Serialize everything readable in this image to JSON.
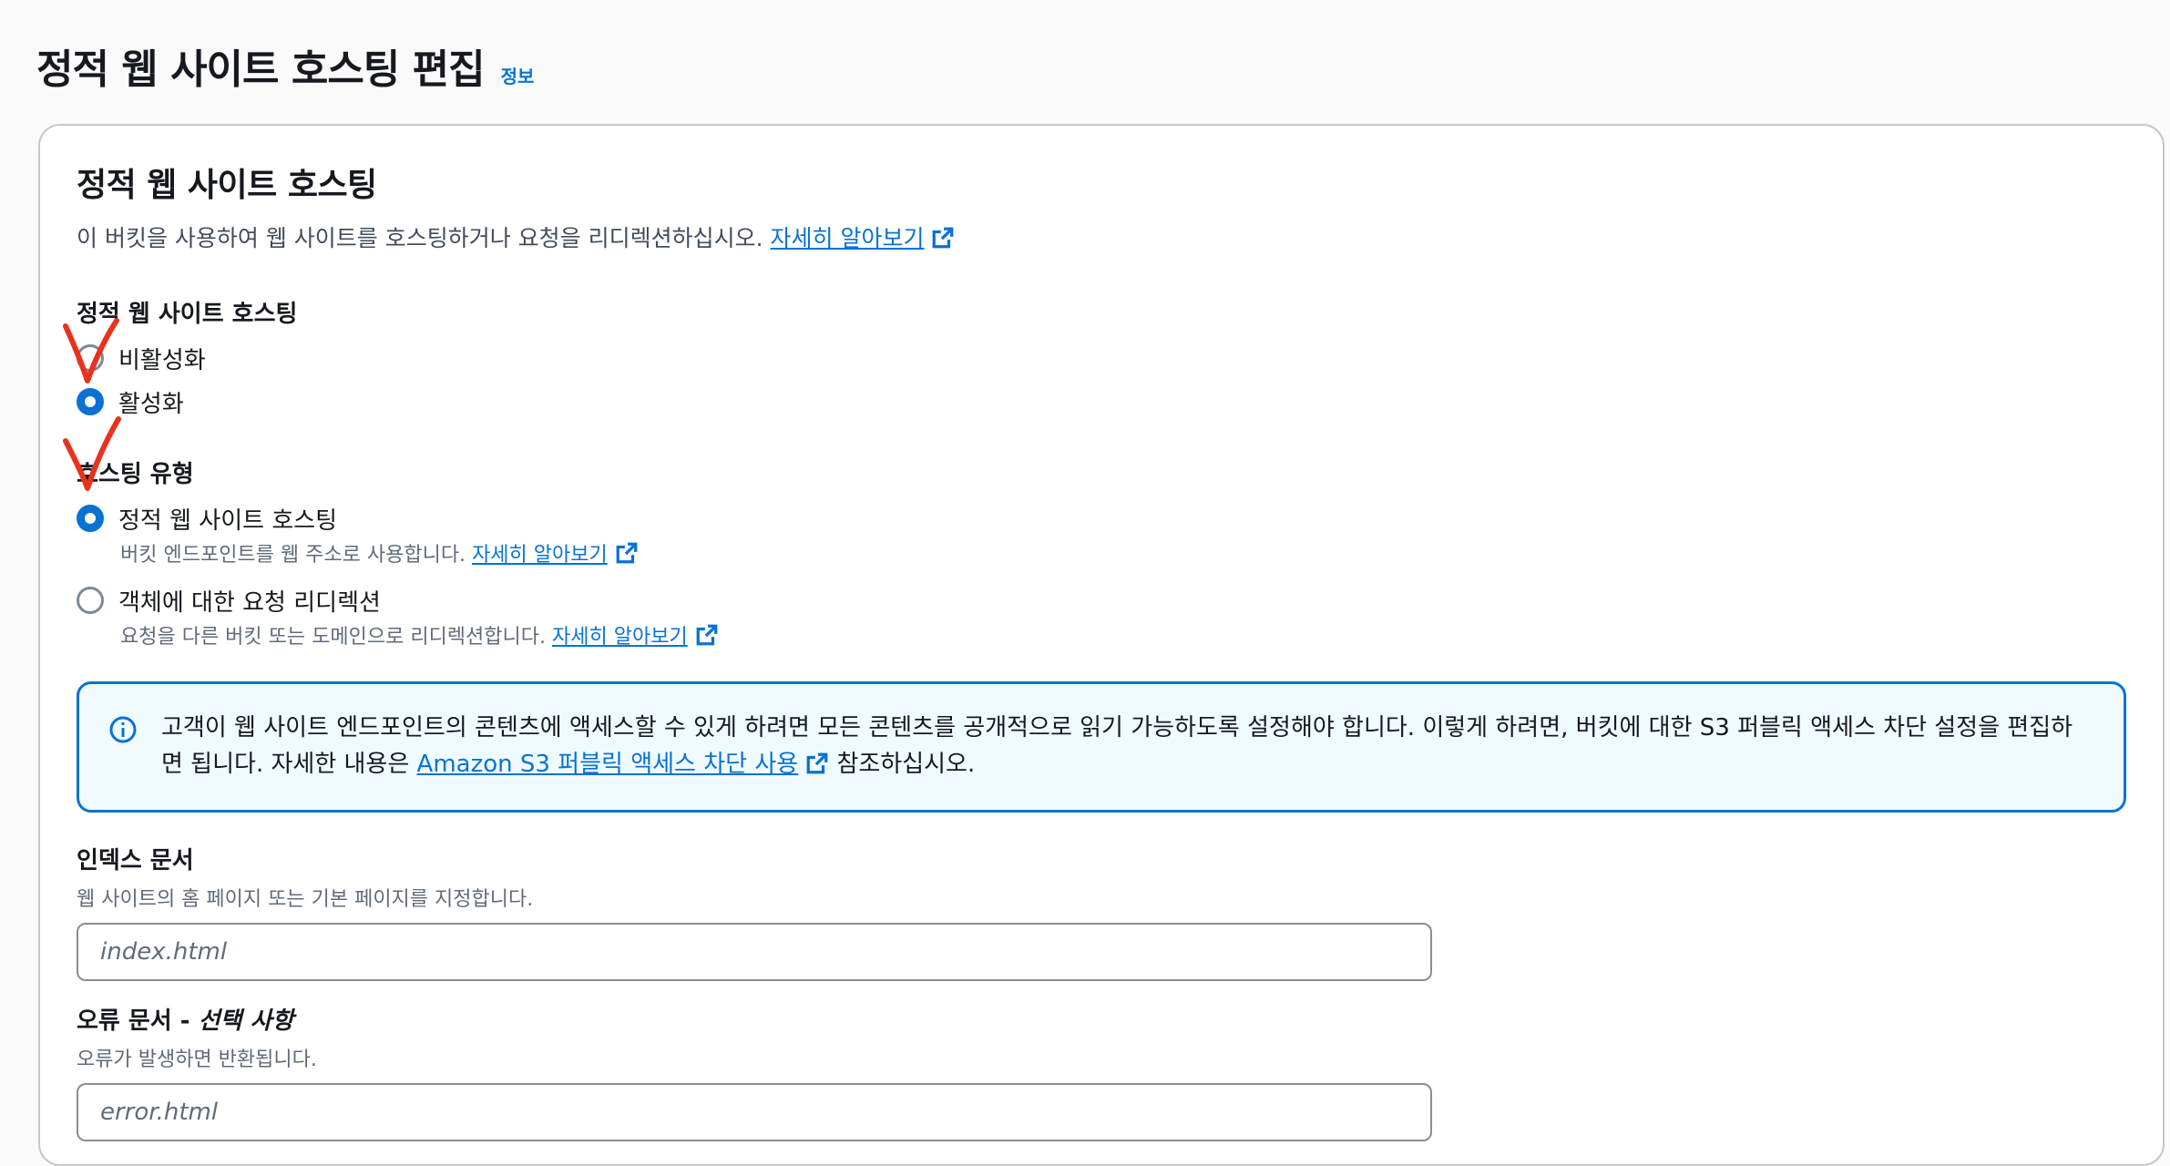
{
  "page": {
    "title": "정적 웹 사이트 호스팅 편집",
    "info_link": "정보"
  },
  "panel": {
    "title": "정적 웹 사이트 호스팅",
    "description": "이 버킷을 사용하여 웹 사이트를 호스팅하거나 요청을 리디렉션하십시오.",
    "learn_more": "자세히 알아보기"
  },
  "hosting": {
    "label": "정적 웹 사이트 호스팅",
    "options": [
      {
        "label": "비활성화",
        "checked": false
      },
      {
        "label": "활성화",
        "checked": true
      }
    ]
  },
  "hosting_type": {
    "label": "호스팅 유형",
    "options": [
      {
        "label": "정적 웹 사이트 호스팅",
        "description": "버킷 엔드포인트를 웹 주소로 사용합니다.",
        "learn_more": "자세히 알아보기",
        "checked": true
      },
      {
        "label": "객체에 대한 요청 리디렉션",
        "description": "요청을 다른 버킷 또는 도메인으로 리디렉션합니다.",
        "learn_more": "자세히 알아보기",
        "checked": false
      }
    ]
  },
  "alert": {
    "text_before": "고객이 웹 사이트 엔드포인트의 콘텐츠에 액세스할 수 있게 하려면 모든 콘텐츠를 공개적으로 읽기 가능하도록 설정해야 합니다. 이렇게 하려면, 버킷에 대한 S3 퍼블릭 액세스 차단 설정을 편집하면 됩니다. 자세한 내용은",
    "link": "Amazon S3 퍼블릭 액세스 차단 사용",
    "text_after": "참조하십시오."
  },
  "index_document": {
    "label": "인덱스 문서",
    "description": "웹 사이트의 홈 페이지 또는 기본 페이지를 지정합니다.",
    "placeholder": "index.html",
    "value": ""
  },
  "error_document": {
    "label": "오류 문서",
    "label_separator": " - ",
    "label_optional": "선택 사항",
    "description": "오류가 발생하면 반환됩니다.",
    "placeholder": "error.html",
    "value": ""
  },
  "colors": {
    "accent": "#0972d3",
    "annotation": "#e8321e",
    "alert_background": "#f0fbff"
  },
  "icons": {
    "external_link": "external-link-icon",
    "info": "info-circle-icon"
  }
}
